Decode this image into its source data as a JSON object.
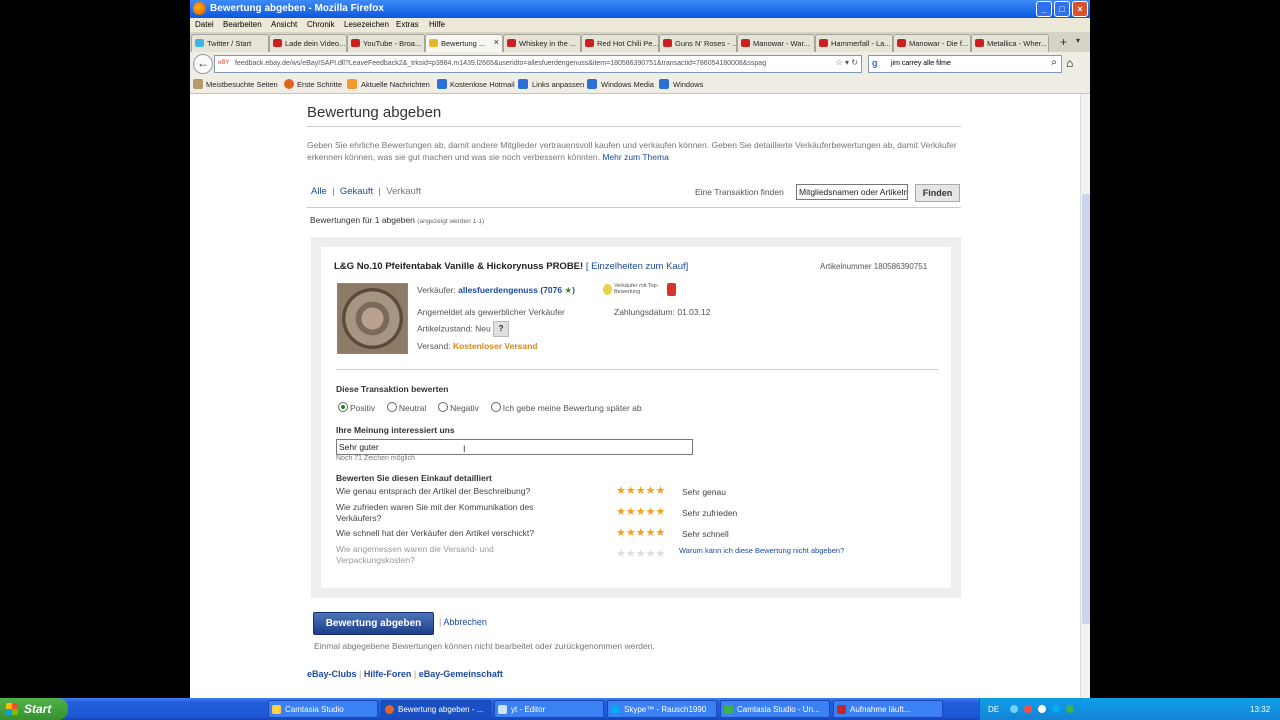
{
  "browser": {
    "title": "Bewertung abgeben - Mozilla Firefox",
    "menu": [
      "Datei",
      "Bearbeiten",
      "Ansicht",
      "Chronik",
      "Lesezeichen",
      "Extras",
      "Hilfe"
    ],
    "tabs": [
      "Twitter / Start",
      "Lade dein Video...",
      "YouTube - Broa...",
      "Bewertung ...",
      "Whiskey in the ...",
      "Red Hot Chili Pe...",
      "Guns N' Roses - ...",
      "Manowar - War...",
      "Hammerfall - La...",
      "Manowar - Die f...",
      "Metallica - Wher..."
    ],
    "url": "feedback.ebay.de/ws/eBayISAPI.dll?LeaveFeedback2&_trksid=p3984.m1439.l2665&useridto=allesfuerdengenuss&item=180586390751&transactid=786054180008&sspag",
    "url_badge": "eBY",
    "search": "jim carrey alle filme",
    "bookmarks": [
      "Meistbesuchte Seiten",
      "Erste Schritte",
      "Aktuelle Nachrichten",
      "Kostenlose Hotmail",
      "Links anpassen",
      "Windows Media",
      "Windows"
    ]
  },
  "page": {
    "heading": "Bewertung abgeben",
    "intro": "Geben Sie ehrliche Bewertungen ab, damit andere Mitglieder vertrauensvoll kaufen und verkaufen können. Geben Sie detaillierte Verkäuferbewertungen ab, damit Verkäufer erkennen können, was sie gut machen und was sie noch verbessern könnten.",
    "intro_link": "Mehr zum Thema",
    "filter": {
      "all": "Alle",
      "bought": "Gekauft",
      "sold": "Verkauft"
    },
    "find_label": "Eine Transaktion finden",
    "find_placeholder": "Mitgliedsnamen oder Artikelnummer",
    "find_button": "Finden",
    "sub_title": "Bewertungen für 1 abgeben",
    "sub_note": "(angezeigt werden 1-1)",
    "item": {
      "title": "L&G No.10 Pfeifentabak Vanille & Hickorynuss PROBE!",
      "details_link": "[ Einzelheiten zum Kauf]",
      "article_number": "Artikelnummer 180586390751",
      "seller_label": "Verkäufer:",
      "seller_name": "allesfuerdengenuss",
      "seller_score": "7076",
      "top_rating": "Verkäufer mit Top-Bewertung",
      "registered": "Angemeldet als gewerblicher Verkäufer",
      "condition_label": "Artikelzustand:",
      "condition": "Neu",
      "payment_label": "Zahlungsdatum:",
      "payment_date": "01.03.12",
      "shipping_label": "Versand:",
      "shipping": "Kostenloser Versand"
    },
    "rate_title": "Diese Transaktion bewerten",
    "ratings": [
      "Positiv",
      "Neutral",
      "Negativ",
      "Ich gebe meine Bewertung später ab"
    ],
    "selected_rating": "Positiv",
    "opinion_title": "Ihre Meinung interessiert uns",
    "comment": "Sehr guter",
    "remaining": "Noch 71 Zeichen möglich",
    "detail_title": "Bewerten Sie diesen Einkauf detailliert",
    "detail_questions": [
      {
        "q": "Wie genau entsprach der Artikel der Beschreibung?",
        "stars": 5,
        "label": "Sehr genau"
      },
      {
        "q": "Wie zufrieden waren Sie mit der Kommunikation des Verkäufers?",
        "stars": 5,
        "label": "Sehr zufrieden"
      },
      {
        "q": "Wie schnell hat der Verkäufer den Artikel verschickt?",
        "stars": 5,
        "label": "Sehr schnell"
      },
      {
        "q": "Wie angemessen waren die Versand- und Verpackungskosten?",
        "stars": 0,
        "label": "Warum kann ich diese Bewertung nicht abgeben?"
      }
    ],
    "submit": "Bewertung abgeben",
    "cancel": "Abbrechen",
    "note": "Einmal abgegebene Bewertungen können nicht bearbeitet oder zurückgenommen werden.",
    "footer": [
      "eBay-Clubs",
      "Hilfe-Foren",
      "eBay-Gemeinschaft"
    ]
  },
  "taskbar": {
    "start": "Start",
    "items": [
      "Camtasia Studio",
      "Bewertung abgeben - ...",
      "yt - Editor",
      "Skype™ - Rausch1990",
      "Camtasia Studio - Un...",
      "Aufnahme läuft..."
    ],
    "lang": "DE",
    "time": "13:32"
  },
  "colors": {
    "link": "#1c4aa2",
    "accent_orange": "#d2881a",
    "star": "#f0a020",
    "taskbar": "#245edb"
  }
}
